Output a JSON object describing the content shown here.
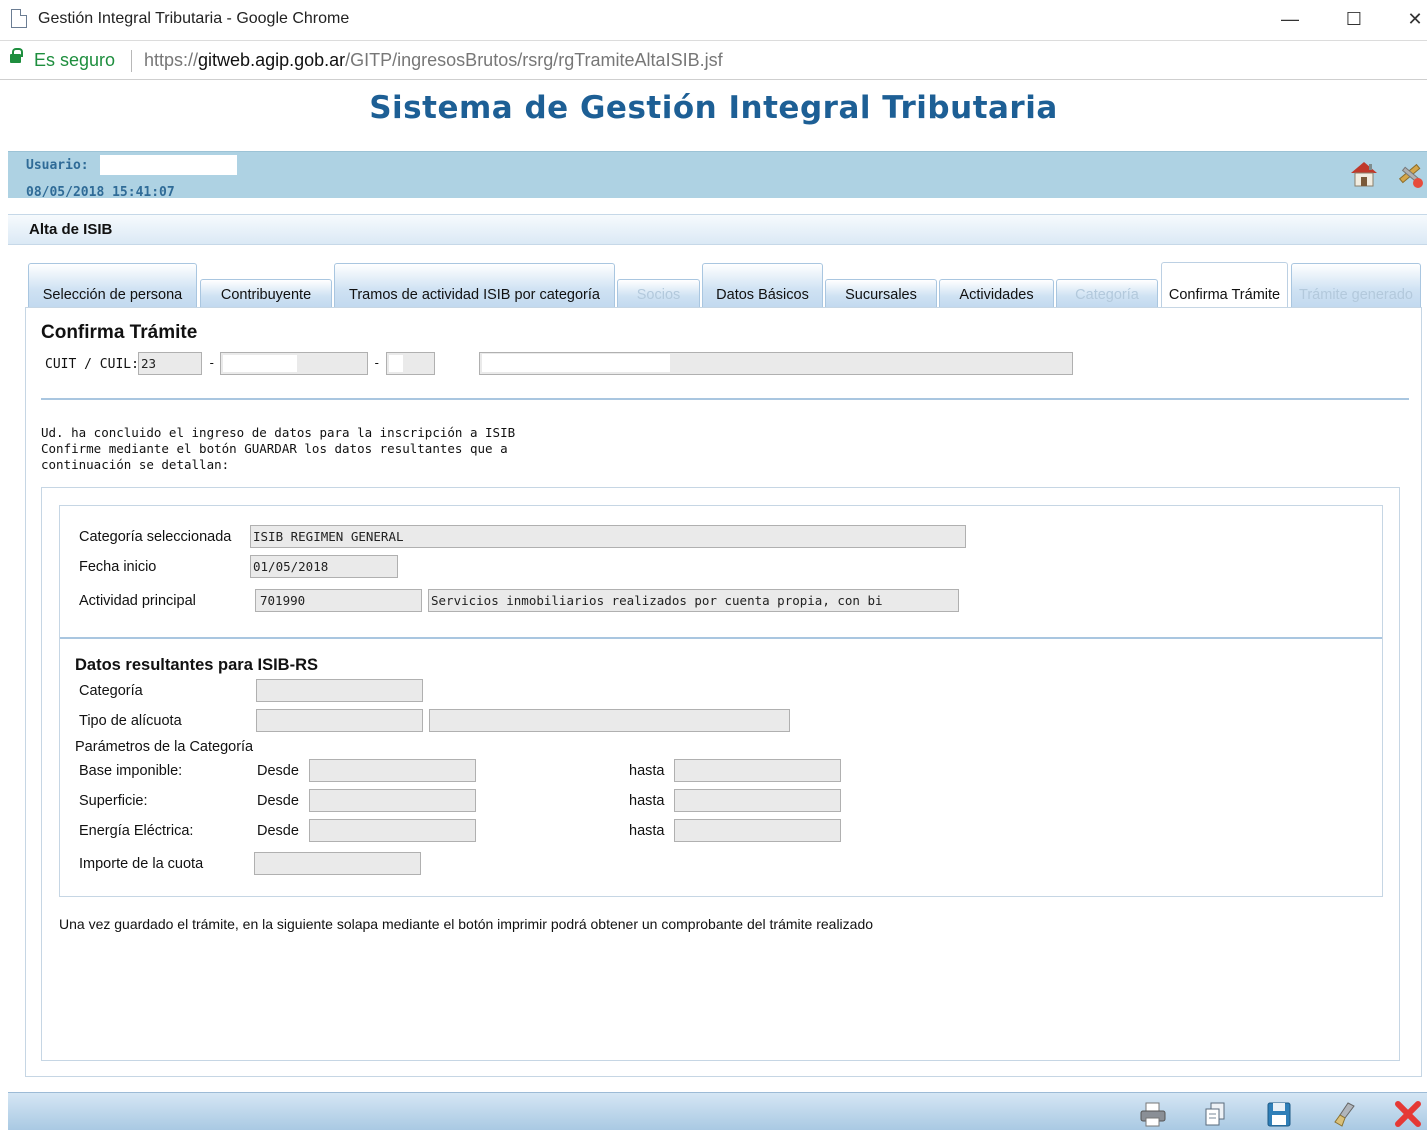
{
  "window": {
    "title": "Gestión Integral Tributaria - Google Chrome",
    "minimize": "—",
    "maximize": "☐",
    "close": "✕"
  },
  "address": {
    "secure": "Es seguro",
    "url_prefix": "https://",
    "url_host": "gitweb.agip.gob.ar",
    "url_path": "/GITP/ingresosBrutos/rsrg/rgTramiteAltaISIB.jsf"
  },
  "header": {
    "title": "Sistema de Gestión Integral Tributaria",
    "user_label": "Usuario:",
    "datetime": "08/05/2018 15:41:07"
  },
  "section": {
    "title": "Alta de ISIB"
  },
  "tabs": [
    {
      "label": "Selección de persona",
      "state": "normal"
    },
    {
      "label": "Contribuyente",
      "state": "normal"
    },
    {
      "label": "Tramos de actividad ISIB por categoría",
      "state": "normal"
    },
    {
      "label": "Socios",
      "state": "disabled"
    },
    {
      "label": "Datos Básicos",
      "state": "normal"
    },
    {
      "label": "Sucursales",
      "state": "normal"
    },
    {
      "label": "Actividades",
      "state": "normal"
    },
    {
      "label": "Categoría",
      "state": "disabled"
    },
    {
      "label": "Confirma Trámite",
      "state": "active"
    },
    {
      "label": "Trámite generado",
      "state": "disabled"
    }
  ],
  "confirm": {
    "heading": "Confirma Trámite",
    "cuit_label": "CUIT / CUIL:",
    "cuit_prefix": "23",
    "dash": "-",
    "intro_line1": "Ud. ha concluido el ingreso de datos para la inscripción a ISIB",
    "intro_line2": "Confirme mediante el botón GUARDAR los datos resultantes que a",
    "intro_line3": "continuación se detallan:"
  },
  "details": {
    "categoria_label": "Categoría seleccionada",
    "categoria_value": "ISIB REGIMEN GENERAL",
    "fecha_label": "Fecha inicio",
    "fecha_value": "01/05/2018",
    "actividad_label": "Actividad principal",
    "actividad_code": "701990",
    "actividad_desc": "Servicios inmobiliarios realizados por cuenta propia, con bi"
  },
  "rs": {
    "heading": "Datos resultantes para ISIB-RS",
    "categoria_label": "Categoría",
    "alicuota_label": "Tipo de alícuota",
    "params_label": "Parámetros de la Categoría",
    "base_label": "Base imponible:",
    "superficie_label": "Superficie:",
    "energia_label": "Energía Eléctrica:",
    "desde": "Desde",
    "hasta": "hasta",
    "importe_label": "Importe de la cuota"
  },
  "note": "Una vez guardado el trámite, en la siguiente solapa mediante el botón imprimir podrá obtener un comprobante del trámite realizado",
  "icons": {
    "header": [
      "home-icon",
      "tools-icon"
    ],
    "footer": [
      "print-icon",
      "copy-icon",
      "save-icon",
      "clear-icon",
      "close-icon"
    ]
  },
  "colors": {
    "title_blue": "#1d5f95",
    "userbar": "#aed2e3",
    "close_red": "#e53935"
  }
}
